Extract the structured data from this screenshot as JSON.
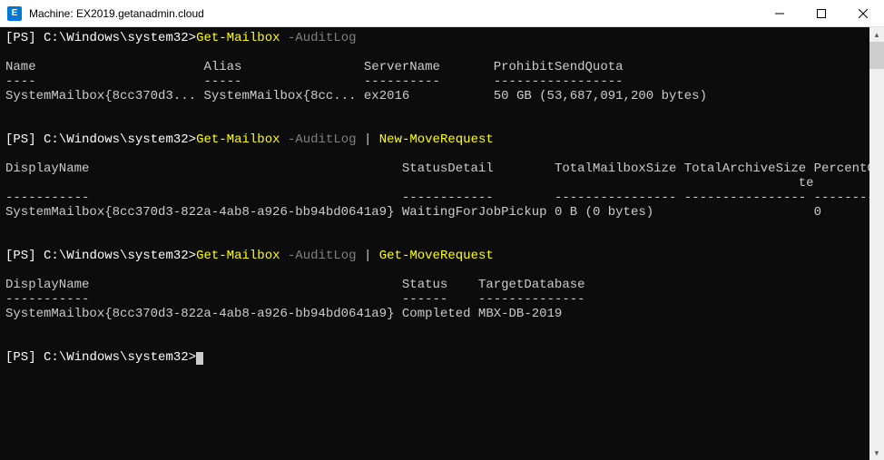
{
  "window": {
    "app_icon_text": "E",
    "title": "Machine: EX2019.getanadmin.cloud"
  },
  "prompt": {
    "bracket_open": "[",
    "ps": "PS",
    "bracket_close": "]",
    "path": "C:\\Windows\\system32",
    "gt": ">"
  },
  "cmd1": {
    "cmdlet": "Get-Mailbox",
    "param": "-AuditLog"
  },
  "out1": {
    "hdr_name": "Name",
    "hdr_alias": "Alias",
    "hdr_server": "ServerName",
    "hdr_quota": "ProhibitSendQuota",
    "sep_name": "----",
    "sep_alias": "-----",
    "sep_server": "----------",
    "sep_quota": "-----------------",
    "row_name": "SystemMailbox{8cc370d3...",
    "row_alias": "SystemMailbox{8cc...",
    "row_server": "ex2016",
    "row_quota": "50 GB (53,687,091,200 bytes)"
  },
  "cmd2": {
    "cmdlet1": "Get-Mailbox",
    "param": "-AuditLog",
    "pipe": "|",
    "cmdlet2": "New-MoveRequest"
  },
  "out2": {
    "hdr_display": "DisplayName",
    "hdr_status": "StatusDetail",
    "hdr_total": "TotalMailboxSize",
    "hdr_archive": "TotalArchiveSize",
    "hdr_percent": "PercentComple",
    "hdr_percent2": "te",
    "sep_display": "-----------",
    "sep_status": "------------",
    "sep_total": "----------------",
    "sep_archive": "----------------",
    "sep_percent": "-------------",
    "row_display": "SystemMailbox{8cc370d3-822a-4ab8-a926-bb94bd0641a9}",
    "row_status": "WaitingForJobPickup",
    "row_total": "0 B (0 bytes)",
    "row_percent": "0"
  },
  "cmd3": {
    "cmdlet1": "Get-Mailbox",
    "param": "-AuditLog",
    "pipe": "|",
    "cmdlet2": "Get-MoveRequest"
  },
  "out3": {
    "hdr_display": "DisplayName",
    "hdr_status": "Status",
    "hdr_target": "TargetDatabase",
    "sep_display": "-----------",
    "sep_status": "------",
    "sep_target": "--------------",
    "row_display": "SystemMailbox{8cc370d3-822a-4ab8-a926-bb94bd0641a9}",
    "row_status": "Completed",
    "row_target": "MBX-DB-2019"
  }
}
